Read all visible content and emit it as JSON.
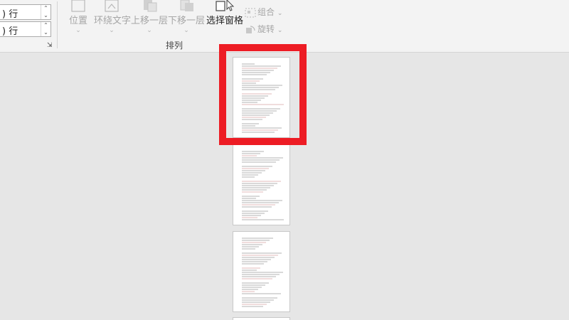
{
  "ribbon": {
    "spin_top": {
      "value": ") 行"
    },
    "spin_bottom": {
      "value": ") 行"
    },
    "position_label": "位置",
    "wrap_text_label": "环绕文字",
    "bring_forward_label": "上移一层",
    "send_backward_label": "下移一层",
    "selection_pane_label": "选择窗格",
    "group_label": "组合",
    "rotate_label": "旋转",
    "arrange_group_label": "排列"
  },
  "colors": {
    "highlight": "#ed1c24",
    "ribbon_bg": "#f3f3f3",
    "canvas_bg": "#e6e6e6"
  }
}
